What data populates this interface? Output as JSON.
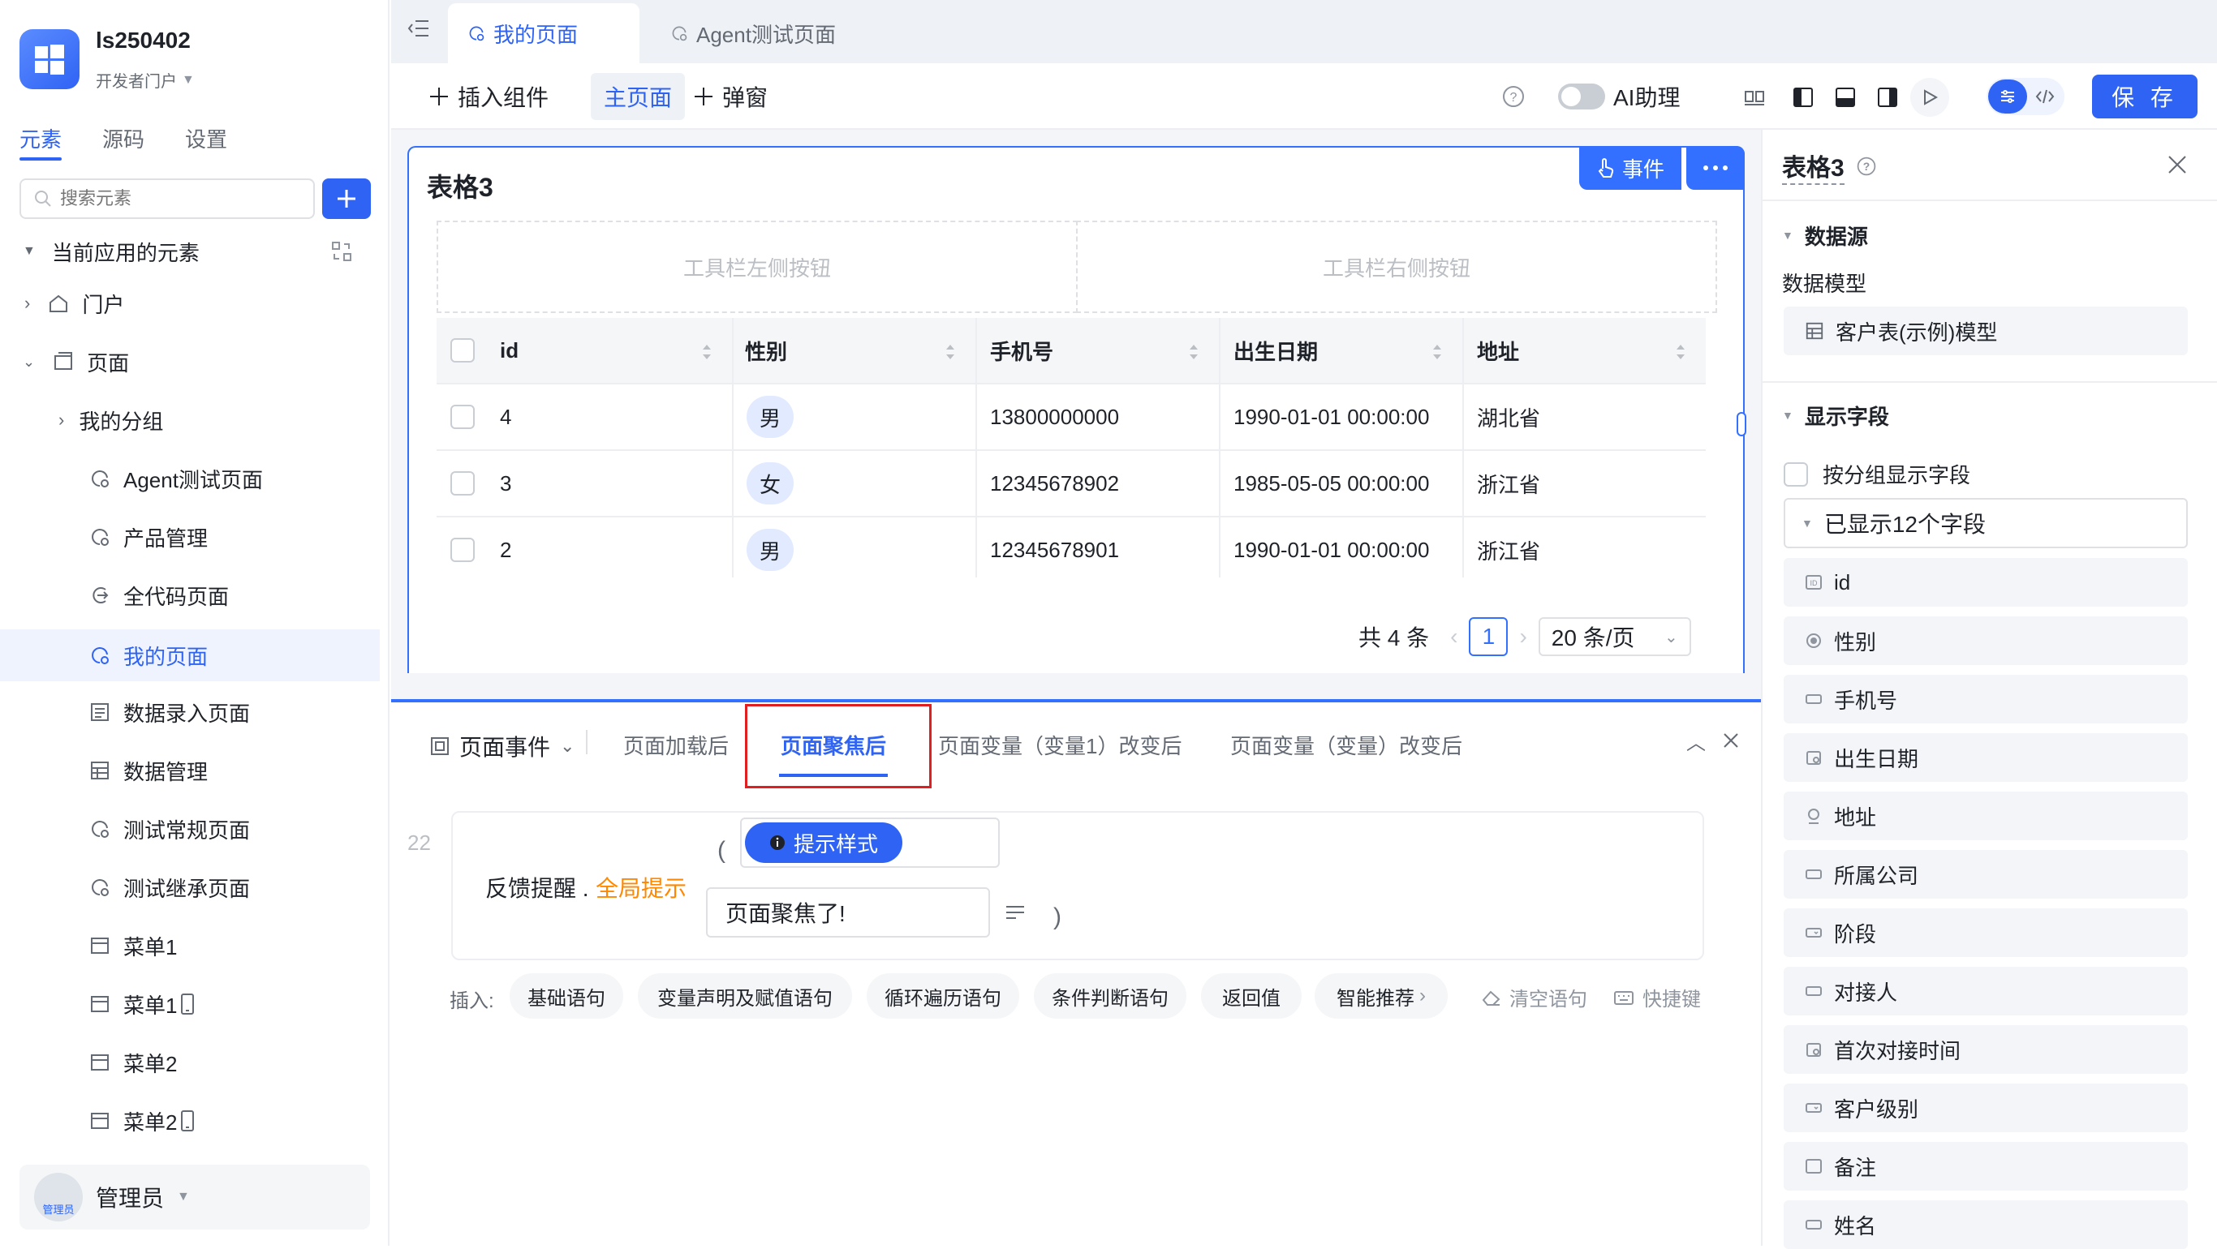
{
  "app": {
    "name": "ls250402",
    "portal": "开发者门户"
  },
  "left_tabs": [
    "元素",
    "源码",
    "设置"
  ],
  "search": {
    "placeholder": "搜索元素"
  },
  "tree": {
    "root": "当前应用的元素",
    "items": [
      {
        "label": "门户"
      },
      {
        "label": "页面"
      },
      {
        "label": "我的分组"
      },
      {
        "label": "Agent测试页面"
      },
      {
        "label": "产品管理"
      },
      {
        "label": "全代码页面"
      },
      {
        "label": "我的页面"
      },
      {
        "label": "数据录入页面"
      },
      {
        "label": "数据管理"
      },
      {
        "label": "测试常规页面"
      },
      {
        "label": "测试继承页面"
      },
      {
        "label": "菜单1"
      },
      {
        "label": "菜单1"
      },
      {
        "label": "菜单2"
      },
      {
        "label": "菜单2"
      }
    ]
  },
  "user": {
    "name": "管理员",
    "avatar_text": "管理员"
  },
  "page_tabs": [
    "我的页面",
    "Agent测试页面"
  ],
  "toolbar": {
    "insert": "插入组件",
    "main_page": "主页面",
    "popup": "弹窗",
    "ai": "AI助理",
    "save": "保 存"
  },
  "table_card": {
    "title": "表格3",
    "event_btn": "事件",
    "toolbar_left": "工具栏左侧按钮",
    "toolbar_right": "工具栏右侧按钮",
    "columns": [
      "id",
      "性别",
      "手机号",
      "出生日期",
      "地址"
    ],
    "rows": [
      {
        "id": "4",
        "gender": "男",
        "phone": "13800000000",
        "birth": "1990-01-01 00:00:00",
        "addr": "湖北省"
      },
      {
        "id": "3",
        "gender": "女",
        "phone": "12345678902",
        "birth": "1985-05-05 00:00:00",
        "addr": "浙江省"
      },
      {
        "id": "2",
        "gender": "男",
        "phone": "12345678901",
        "birth": "1990-01-01 00:00:00",
        "addr": "浙江省"
      }
    ],
    "pager": {
      "total": "共 4 条",
      "page": "1",
      "size": "20 条/页"
    }
  },
  "events": {
    "dropdown": "页面事件",
    "tabs": [
      "页面加载后",
      "页面聚焦后",
      "页面变量（变量1）改变后",
      "页面变量（变量）改变后"
    ],
    "line_no": "22",
    "stmt_prefix": "反馈提醒 .",
    "stmt_fn": "全局提示",
    "style_tag": "提示样式",
    "message": "页面聚焦了!",
    "insert_label": "插入:",
    "chips": [
      "基础语句",
      "变量声明及赋值语句",
      "循环遍历语句",
      "条件判断语句",
      "返回值",
      "智能推荐"
    ],
    "clear": "清空语句",
    "shortcut": "快捷键"
  },
  "right_panel": {
    "title": "表格3",
    "datasource": "数据源",
    "model_label": "数据模型",
    "model": "客户表(示例)模型",
    "fields_title": "显示字段",
    "group_check": "按分组显示字段",
    "shown_count": "已显示12个字段",
    "fields": [
      "id",
      "性别",
      "手机号",
      "出生日期",
      "地址",
      "所属公司",
      "阶段",
      "对接人",
      "首次对接时间",
      "客户级别",
      "备注",
      "姓名"
    ]
  },
  "colors": {
    "accent": "#2f63f4",
    "highlight": "#e02020",
    "orange": "#ff8800"
  }
}
